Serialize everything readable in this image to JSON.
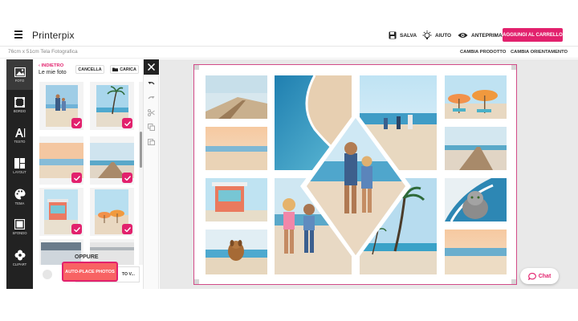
{
  "header": {
    "logo": "Printerpix",
    "save_label": "SALVA",
    "help_label": "AIUTO",
    "preview_label": "ANTEPRIMA",
    "cart_label": "AGGIUNGI AL CARRELLO"
  },
  "subbar": {
    "size_label": "76cm x 51cm Tela Fotografica",
    "change_product": "CAMBIA PRODOTTO",
    "change_orientation": "CAMBIA ORIENTAMENTO"
  },
  "toolbar": {
    "items": [
      {
        "label": "FOTO",
        "icon": "photo-icon"
      },
      {
        "label": "BORDO",
        "icon": "border-icon"
      },
      {
        "label": "TESTO",
        "icon": "text-icon"
      },
      {
        "label": "LAYOUT",
        "icon": "layout-icon"
      },
      {
        "label": "TEMA",
        "icon": "palette-icon"
      },
      {
        "label": "SFONDO",
        "icon": "background-icon"
      },
      {
        "label": "CLIPART",
        "icon": "clipart-icon"
      }
    ]
  },
  "panel": {
    "back_label": "INDIETRO",
    "title": "Le mie foto",
    "clear_label": "CANCELLA",
    "upload_label": "CARICA",
    "or_label": "OPPURE",
    "upload_more_label": "TO V...",
    "autoplace_label": "AUTO-PLACE PHOTOS"
  },
  "chat": {
    "label": "Chat"
  },
  "colors": {
    "accent": "#e2216d",
    "toolbar": "#222222",
    "autoplace": "#f86363"
  }
}
